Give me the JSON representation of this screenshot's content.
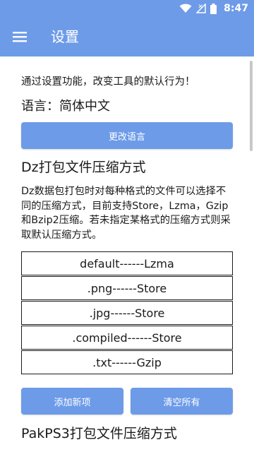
{
  "status_bar": {
    "time": "8:47"
  },
  "app_bar": {
    "title": "设置"
  },
  "intro": "通过设置功能，改变工具的默认行为！",
  "language": {
    "text": "语言：简体中文",
    "change_button": "更改语言"
  },
  "dz_section": {
    "title": "Dz打包文件压缩方式",
    "description": "Dz数据包打包时对每种格式的文件可以选择不同的压缩方式，目前支持Store，Lzma，Gzip和Bzip2压缩。若未指定某格式的压缩方式则采取默认压缩方式。",
    "formats": [
      "default------Lzma",
      ".png------Store",
      ".jpg------Store",
      ".compiled------Store",
      ".txt------Gzip"
    ],
    "add_button": "添加新项",
    "clear_button": "清空所有"
  },
  "pak_section": {
    "title": "PakPS3打包文件压缩方式"
  },
  "colors": {
    "primary": "#6d9be8",
    "text": "#1a1a1a"
  }
}
